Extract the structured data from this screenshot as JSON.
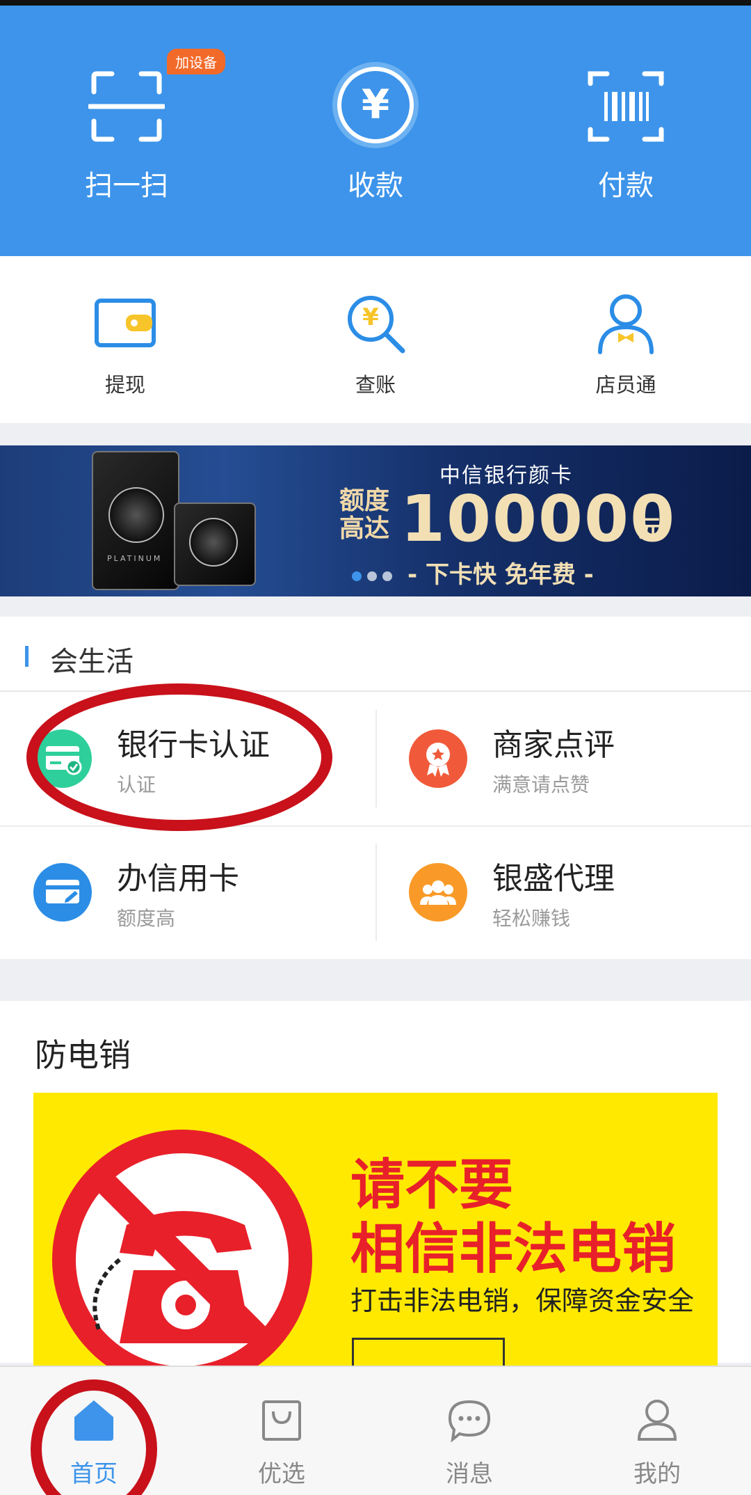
{
  "hero": {
    "scan_label": "扫一扫",
    "scan_badge": "加设备",
    "receive_label": "收款",
    "receive_symbol": "¥",
    "pay_label": "付款"
  },
  "quick": {
    "withdraw_label": "提现",
    "bill_label": "查账",
    "bill_symbol": "¥",
    "staff_label": "店员通"
  },
  "banner": {
    "title": "中信银行颜卡",
    "line_a": "额度",
    "line_b": "高达",
    "amount": "100000",
    "unit": "元",
    "tagline": "- 下卡快 免年费 -",
    "card_text": "PLATINUM",
    "slides": 3,
    "active_slide": 1
  },
  "life": {
    "section_title": "会生活",
    "items": [
      {
        "title": "银行卡认证",
        "subtitle": "认证",
        "color": "#2ecf9a"
      },
      {
        "title": "商家点评",
        "subtitle": "满意请点赞",
        "color": "#f05a3a"
      },
      {
        "title": "办信用卡",
        "subtitle": "额度高",
        "color": "#2b8de6"
      },
      {
        "title": "银盛代理",
        "subtitle": "轻松赚钱",
        "color": "#f99a28"
      }
    ]
  },
  "fraud": {
    "section_title": "防电销",
    "line1": "请不要",
    "line2": "相信非法电销",
    "line3": "打击非法电销，保障资金安全"
  },
  "tabs": [
    {
      "label": "首页",
      "icon": "home-icon",
      "active": true
    },
    {
      "label": "优选",
      "icon": "shopping-bag-icon",
      "active": false
    },
    {
      "label": "消息",
      "icon": "message-icon",
      "active": false
    },
    {
      "label": "我的",
      "icon": "profile-icon",
      "active": false
    }
  ],
  "colors": {
    "primary": "#3d94ea",
    "badge": "#f26a2a",
    "annotation": "#c8111a",
    "alert_bg": "#ffe900",
    "alert_text": "#e8202a"
  }
}
